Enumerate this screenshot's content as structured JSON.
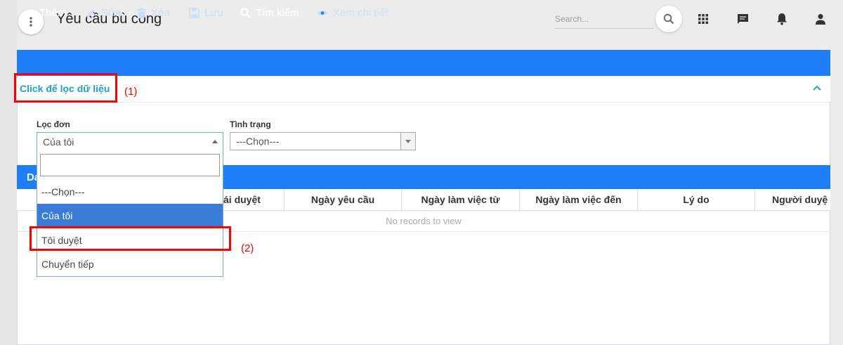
{
  "header": {
    "title": "Yêu cầu bù công",
    "search_placeholder": "Search...",
    "icons": [
      "more-vert-icon",
      "search-icon",
      "apps-grid-icon",
      "chat-icon",
      "bell-icon",
      "person-icon"
    ]
  },
  "toolbar": {
    "add": "Thêm",
    "edit": "Sửa",
    "delete": "Xóa",
    "save": "Lưu",
    "search": "Tìm kiếm",
    "view": "Xem chi tiết"
  },
  "filter": {
    "toggle_label": "Click để lọc dữ liệu",
    "loc_don": {
      "label": "Lọc đơn",
      "selected": "Của tôi",
      "options": [
        "---Chọn---",
        "Của tôi",
        "Tôi duyệt",
        "Chuyển tiếp"
      ]
    },
    "tinh_trang": {
      "label": "Tình trạng",
      "selected": "---Chọn---"
    }
  },
  "grid": {
    "title_fragment": "Da",
    "columns": [
      "ái duyệt",
      "Ngày yêu cầu",
      "Ngày làm việc từ",
      "Ngày làm việc đến",
      "Lý do",
      "Người duyệ"
    ],
    "empty_text": "No records to view"
  },
  "annotations": {
    "step1": "(1)",
    "step2": "(2)"
  },
  "colors": {
    "toolbar_blue": "#1e7ef7",
    "link_teal": "#22a3c2",
    "selected_option": "#3a7dd8",
    "annotation_red": "#ff0000"
  }
}
